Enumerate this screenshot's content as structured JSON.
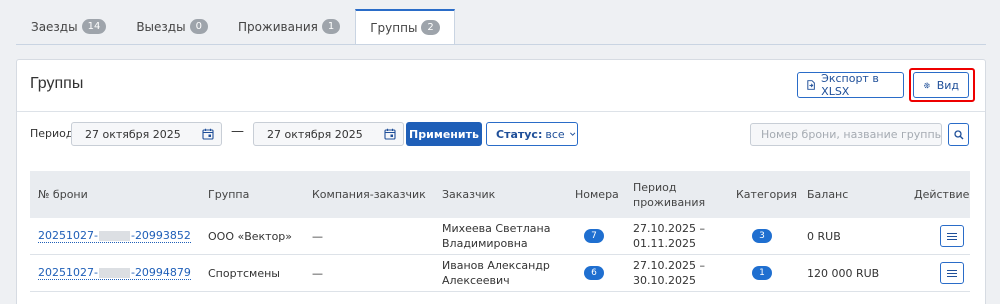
{
  "tabs": [
    {
      "label": "Заезды",
      "count": "14"
    },
    {
      "label": "Выезды",
      "count": "0"
    },
    {
      "label": "Проживания",
      "count": "1"
    },
    {
      "label": "Группы",
      "count": "2",
      "active": true
    }
  ],
  "card": {
    "title": "Группы",
    "export_label": "Экспорт в XLSX",
    "view_label": "Вид"
  },
  "filters": {
    "period_label": "Период:",
    "date_from": "27 октября 2025",
    "date_separator": "—",
    "date_to": "27 октября 2025",
    "apply_label": "Применить",
    "status_prefix": "Статус:",
    "status_value": "все",
    "search_placeholder": "Номер брони, название группы, з"
  },
  "table": {
    "columns": {
      "booking": "№ брони",
      "group": "Группа",
      "company": "Компания-заказчик",
      "customer": "Заказчик",
      "rooms": "Номера",
      "period": "Период проживания",
      "category": "Категория",
      "balance": "Баланс",
      "action": "Действие"
    },
    "rows": [
      {
        "booking_prefix": "20251027-",
        "booking_suffix": "-20993852",
        "group": "ООО «Вектор»",
        "company": "—",
        "customer": "Михеева Светлана Владимировна",
        "rooms": "7",
        "period_from": "27.10.2025 –",
        "period_to": "01.11.2025",
        "category": "3",
        "balance": "0 RUB"
      },
      {
        "booking_prefix": "20251027-",
        "booking_suffix": "-20994879",
        "group": "Спортсмены",
        "company": "—",
        "customer": "Иванов Александр Алексеевич",
        "rooms": "6",
        "period_from": "27.10.2025 –",
        "period_to": "30.10.2025",
        "category": "1",
        "balance": "120 000 RUB"
      }
    ]
  },
  "colors": {
    "accent": "#1f5fb8",
    "highlight": "#ee0000"
  }
}
